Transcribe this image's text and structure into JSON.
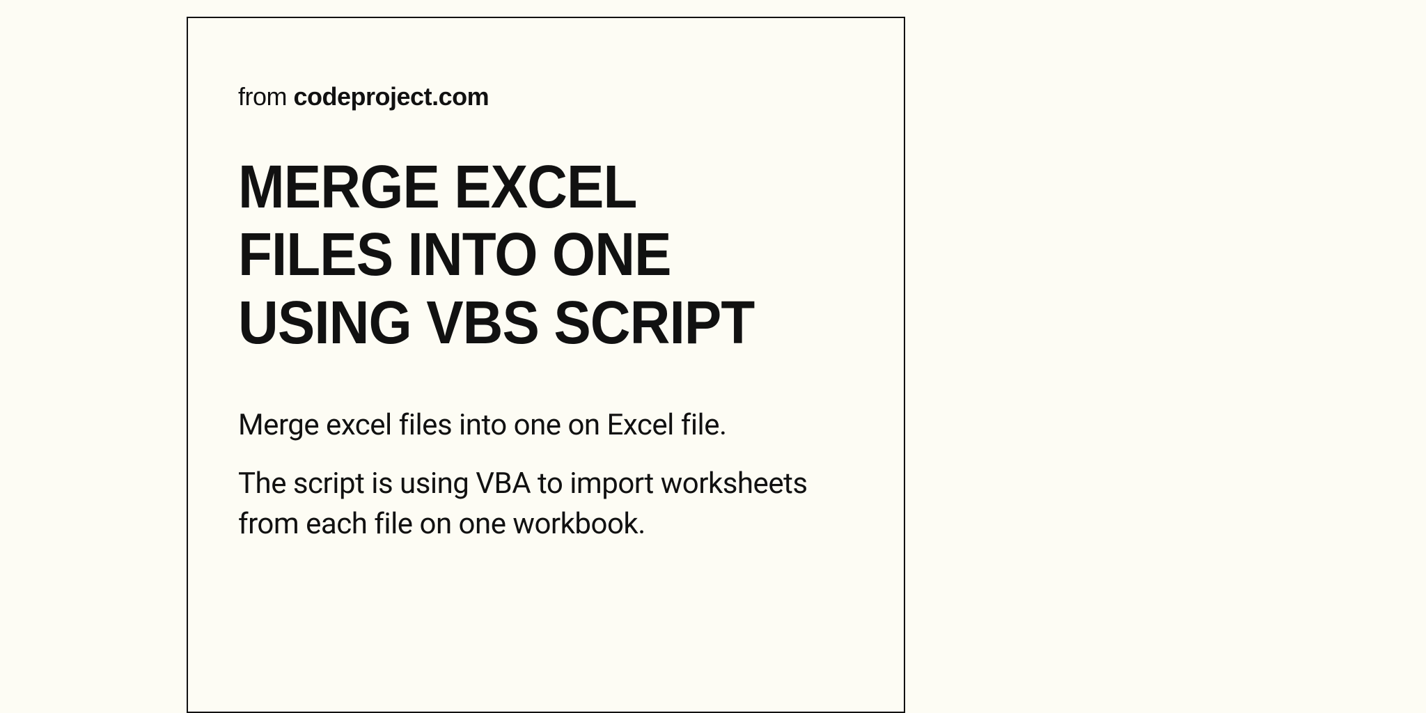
{
  "source": {
    "prefix": "from ",
    "domain": "codeproject.com"
  },
  "headline": "MERGE EXCEL FILES INTO ONE USING VBS SCRIPT",
  "body": {
    "p1": "Merge excel files into one on Excel file.",
    "p2": "The script is using VBA to import worksheets from each file on one workbook."
  }
}
